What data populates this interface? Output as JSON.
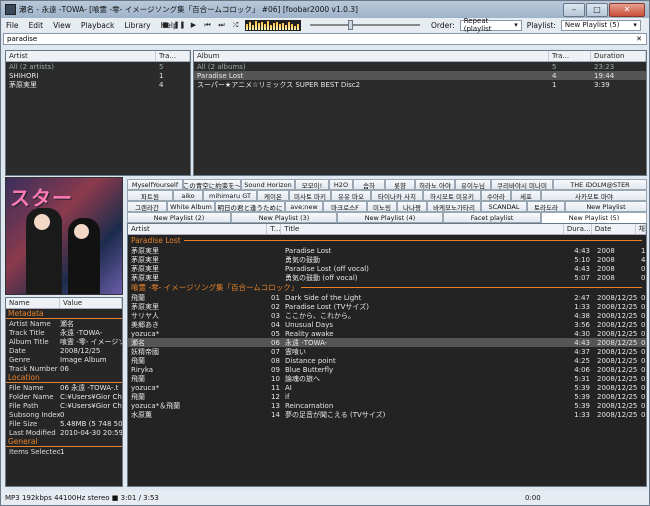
{
  "window": {
    "title": "瀬名 - 永遠 -TOWA- [喰霊 -零- イメージソング集「百合ームコロック」 #06]   [foobar2000 v1.0.3]",
    "min": "–",
    "max": "□",
    "close": "✕"
  },
  "menu": [
    "File",
    "Edit",
    "View",
    "Playback",
    "Library",
    "Help"
  ],
  "toolbar": {
    "order_label": "Order:",
    "order_value": "Repeat (playlist",
    "playlist_label": "Playlist:",
    "playlist_value": "New Playlist (5)"
  },
  "search": {
    "value": "paradise",
    "clear": "✕"
  },
  "artists": {
    "columns": [
      "Artist",
      "Tra..."
    ],
    "rows": [
      [
        "All (2 artists)",
        "5"
      ],
      [
        "SHIHORI",
        "1"
      ],
      [
        "茅原実里",
        "4"
      ]
    ]
  },
  "albums": {
    "columns": [
      "Album",
      "Tra...",
      "Duration"
    ],
    "rows": [
      [
        "All (2 albums)",
        "5",
        "23:23"
      ],
      [
        "Paradise Lost",
        "4",
        "19:44"
      ],
      [
        "スーパー★アニメ☆リミックス SUPER BEST Disc2",
        "1",
        "3:39"
      ]
    ]
  },
  "tabs": {
    "row1": [
      "MyselfYourself",
      "この青空に約束を～",
      "Sound Horizon",
      "모모이!",
      "H2O",
      "솜하",
      "롯향",
      "히라노 아야",
      "유이누님",
      "쿠리바야시 미나미",
      "THE iDOLM@STER"
    ],
    "row2": [
      "파트원",
      "aiko",
      "mihimaru GT",
      "케이온",
      "미사토 마키",
      "유유 마오",
      "타이나카 사치",
      "하시모토 미유키",
      "수아라",
      "세포",
      "사카모토 마야"
    ],
    "row3": [
      "그랜라간",
      "White Album",
      "明日の君と逢うために",
      "ave;new",
      "마크로스F",
      "미노링",
      "나나짱",
      "바케모노가타리",
      "SCANDAL",
      "토라도라",
      "New Playlist"
    ],
    "row4": [
      "New Playlist (2)",
      "New Playlist (3)",
      "New Playlist (4)",
      "Facet playlist",
      "New Playlist (5)"
    ]
  },
  "playlist": {
    "columns": [
      "Artist",
      "T...",
      "Title",
      "Dura...",
      "Date",
      "채"
    ],
    "groups": [
      {
        "name": "Paradise Lost",
        "rows": [
          [
            "茅原実里",
            "",
            "Paradise Lost",
            "4:43",
            "2008",
            "12"
          ],
          [
            "茅原実里",
            "",
            "勇気の鼓動",
            "5:10",
            "2008",
            "4"
          ],
          [
            "茅原実里",
            "",
            "Paradise Lost (off vocal)",
            "4:43",
            "2008",
            "0"
          ],
          [
            "茅原実里",
            "",
            "勇気の鼓動 (off vocal)",
            "5:07",
            "2008",
            "0"
          ]
        ]
      },
      {
        "name": "喰霊 -零- イメージソング集「百合ームコロック」",
        "rows": [
          [
            "飛蘭",
            "01",
            "Dark Side of the Light",
            "2:47",
            "2008/12/25",
            "0"
          ],
          [
            "茅原実里",
            "02",
            "Paradise Lost (TVサイズ)",
            "1:33",
            "2008/12/25",
            "0"
          ],
          [
            "サリヤ人",
            "03",
            "ここから、これから。",
            "4:38",
            "2008/12/25",
            "0"
          ],
          [
            "美郷あき",
            "04",
            "Unusual Days",
            "3:56",
            "2008/12/25",
            "0"
          ],
          [
            "yozuca*",
            "05",
            "Reality awake",
            "4:30",
            "2008/12/25",
            "0"
          ],
          [
            "瀬名",
            "06",
            "永遠 -TOWA-",
            "4:43",
            "2008/12/25",
            "0"
          ],
          [
            "妖精帝國",
            "07",
            "霊喰い",
            "4:37",
            "2008/12/25",
            "0"
          ],
          [
            "飛蘭",
            "08",
            "Distance point",
            "4:25",
            "2008/12/25",
            "0"
          ],
          [
            "Riryka",
            "09",
            "Blue Butterfly",
            "4:06",
            "2008/12/25",
            "0"
          ],
          [
            "飛蘭",
            "10",
            "論魂の旅へ",
            "5:31",
            "2008/12/25",
            "0"
          ],
          [
            "yozuca*",
            "11",
            "AI",
            "5:39",
            "2008/12/25",
            "0"
          ],
          [
            "飛蘭",
            "12",
            "if",
            "5:39",
            "2008/12/25",
            "0"
          ],
          [
            "yozuca*＆飛蘭",
            "13",
            "Reincarnation",
            "5:39",
            "2008/12/25",
            "0"
          ],
          [
            "水原薫",
            "14",
            "夢の足音が聞こえる (TVサイズ)",
            "1:33",
            "2008/12/25",
            "0"
          ]
        ]
      }
    ]
  },
  "properties": {
    "columns": [
      "Name",
      "Value"
    ],
    "sections": [
      {
        "name": "Metadata",
        "rows": [
          [
            "Artist Name",
            "瀬名"
          ],
          [
            "Track Title",
            "永遠 -TOWA-"
          ],
          [
            "Album Title",
            "喰霊 -零- イメージソ"
          ],
          [
            "Date",
            "2008/12/25"
          ],
          [
            "Genre",
            "Image Album"
          ],
          [
            "Track Number",
            "06"
          ]
        ]
      },
      {
        "name": "Location",
        "rows": [
          [
            "File Name",
            "06 永遠 -TOWA-.t"
          ],
          [
            "Folder Name",
            "C:¥Users¥Gior Ch"
          ],
          [
            "File Path",
            "C:¥Users¥Gior Ch"
          ],
          [
            "Subsong Index",
            "0"
          ],
          [
            "File Size",
            "5.48MB (5 748 50"
          ],
          [
            "Last Modified",
            "2010-04-30 20:59"
          ]
        ]
      },
      {
        "name": "General",
        "rows": [
          [
            "Items Selected",
            "1"
          ]
        ]
      }
    ]
  },
  "status": {
    "left": "MP3 192kbps 44100Hz stereo  ■  3:01 / 3:53",
    "right": "0:00"
  }
}
